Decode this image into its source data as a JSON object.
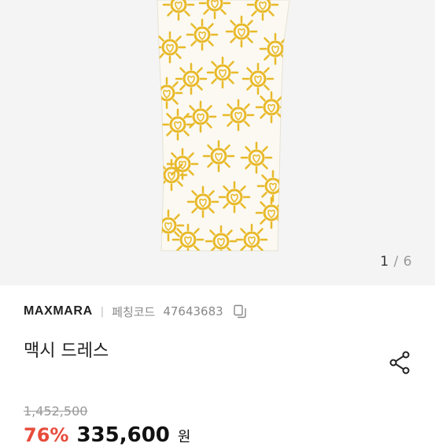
{
  "gallery": {
    "current": "1",
    "separator": "/",
    "total": "6"
  },
  "product": {
    "brand": "MAXMARA",
    "divider": "|",
    "code_label": "페칭코드",
    "code_value": "47643683",
    "title": "맥시 드레스"
  },
  "price": {
    "original": "1,452,500",
    "discount": "76%",
    "sale": "335,600",
    "currency": "원"
  },
  "icons": {
    "copy": "copy-icon",
    "share": "share-icon"
  },
  "colors": {
    "discount": "#e74c3c",
    "sun": "#e8b92a"
  }
}
